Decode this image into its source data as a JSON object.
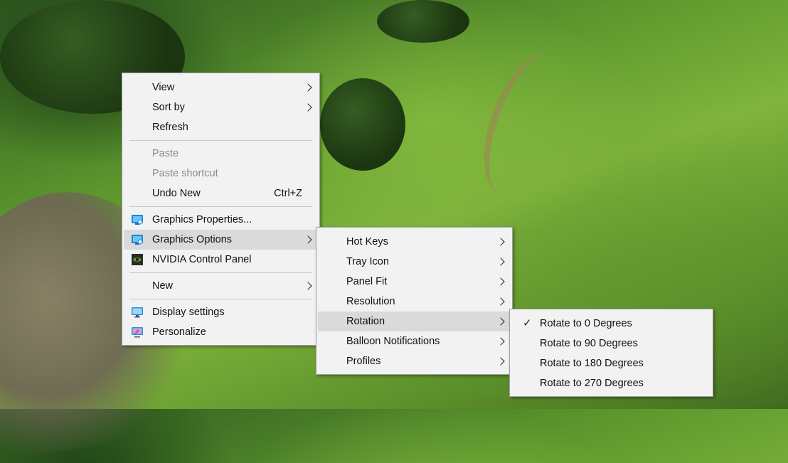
{
  "context_menu": {
    "items": {
      "view": {
        "label": "View"
      },
      "sort_by": {
        "label": "Sort by"
      },
      "refresh": {
        "label": "Refresh"
      },
      "paste": {
        "label": "Paste"
      },
      "paste_shortcut": {
        "label": "Paste shortcut"
      },
      "undo_new": {
        "label": "Undo New",
        "shortcut": "Ctrl+Z"
      },
      "graphics_properties": {
        "label": "Graphics Properties...",
        "icon": "intel-graphics-icon"
      },
      "graphics_options": {
        "label": "Graphics Options",
        "icon": "intel-graphics-icon"
      },
      "nvidia_control_panel": {
        "label": "NVIDIA Control Panel",
        "icon": "nvidia-icon"
      },
      "new": {
        "label": "New"
      },
      "display_settings": {
        "label": "Display settings",
        "icon": "monitor-icon"
      },
      "personalize": {
        "label": "Personalize",
        "icon": "personalize-icon"
      }
    }
  },
  "graphics_options_menu": {
    "items": {
      "hot_keys": {
        "label": "Hot Keys"
      },
      "tray_icon": {
        "label": "Tray Icon"
      },
      "panel_fit": {
        "label": "Panel Fit"
      },
      "resolution": {
        "label": "Resolution"
      },
      "rotation": {
        "label": "Rotation"
      },
      "balloon_notifications": {
        "label": "Balloon Notifications"
      },
      "profiles": {
        "label": "Profiles"
      }
    }
  },
  "rotation_menu": {
    "items": {
      "rotate_0": {
        "label": "Rotate to 0 Degrees",
        "checked": true
      },
      "rotate_90": {
        "label": "Rotate to 90 Degrees"
      },
      "rotate_180": {
        "label": "Rotate to 180 Degrees"
      },
      "rotate_270": {
        "label": "Rotate to 270 Degrees"
      }
    }
  },
  "colors": {
    "menu_bg": "#f2f2f2",
    "highlight": "#dadada",
    "disabled_text": "#8a8a8a"
  }
}
